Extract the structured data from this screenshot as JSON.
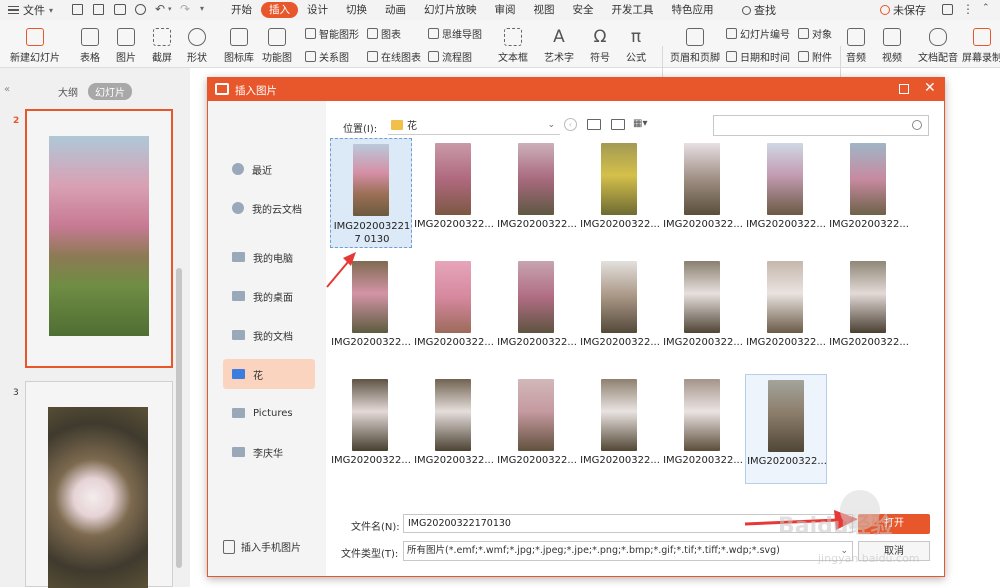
{
  "app": {
    "menu_label": "文件",
    "tabs": [
      "开始",
      "插入",
      "设计",
      "切换",
      "动画",
      "幻灯片放映",
      "审阅",
      "视图",
      "安全",
      "开发工具",
      "特色应用"
    ],
    "active_tab": "插入",
    "search_label": "查找",
    "save_status": "未保存"
  },
  "ribbon": {
    "new_slide": "新建幻灯片",
    "table": "表格",
    "picture": "图片",
    "screenshot": "截屏",
    "shape": "形状",
    "icon_lib": "图标库",
    "func_chart": "功能图",
    "smart_art": "智能图形",
    "chart": "图表",
    "mindmap": "思维导图",
    "relation": "关系图",
    "online_chart": "在线图表",
    "flowchart": "流程图",
    "textbox": "文本框",
    "art_text": "艺术字",
    "symbol": "符号",
    "formula": "公式",
    "header_footer": "页眉和页脚",
    "slide_number": "幻灯片编号",
    "object": "对象",
    "date_time": "日期和时间",
    "attachment": "附件",
    "audio": "音频",
    "video": "视频",
    "narration": "文档配音",
    "screen_record": "屏幕录制"
  },
  "left_panel": {
    "tab_outline": "大纲",
    "tab_slides": "幻灯片",
    "slide_numbers": [
      "2",
      "3"
    ]
  },
  "dialog": {
    "title": "插入图片",
    "location_label": "位置(I):",
    "location_value": "花",
    "search_placeholder": "",
    "sidebar": [
      {
        "label": "最近",
        "icon": "clock-icon"
      },
      {
        "label": "我的云文档",
        "icon": "cloud-doc-icon"
      },
      {
        "label": "我的电脑",
        "icon": "computer-icon"
      },
      {
        "label": "我的桌面",
        "icon": "desktop-icon"
      },
      {
        "label": "我的文档",
        "icon": "folder-icon"
      },
      {
        "label": "花",
        "icon": "folder-icon"
      },
      {
        "label": "Pictures",
        "icon": "folder-icon"
      },
      {
        "label": "李庆华",
        "icon": "folder-icon"
      }
    ],
    "active_sidebar_index": 5,
    "phone_picture": "插入手机图片",
    "files": [
      {
        "name": "IMG20200322170130",
        "caption": "IMG2020032217 0130"
      },
      {
        "name": "IMG20200322...",
        "caption": "IMG20200322..."
      },
      {
        "name": "IMG20200322...",
        "caption": "IMG20200322..."
      },
      {
        "name": "IMG20200322...",
        "caption": "IMG20200322..."
      },
      {
        "name": "IMG20200322...",
        "caption": "IMG20200322..."
      },
      {
        "name": "IMG20200322...",
        "caption": "IMG20200322..."
      },
      {
        "name": "IMG20200322...",
        "caption": "IMG20200322..."
      },
      {
        "name": "IMG20200322...",
        "caption": "IMG20200322..."
      },
      {
        "name": "IMG20200322...",
        "caption": "IMG20200322..."
      },
      {
        "name": "IMG20200322...",
        "caption": "IMG20200322..."
      },
      {
        "name": "IMG20200322...",
        "caption": "IMG20200322..."
      },
      {
        "name": "IMG20200322...",
        "caption": "IMG20200322..."
      },
      {
        "name": "IMG20200322...",
        "caption": "IMG20200322..."
      },
      {
        "name": "IMG20200322...",
        "caption": "IMG20200322..."
      },
      {
        "name": "IMG20200322...",
        "caption": "IMG20200322..."
      },
      {
        "name": "IMG20200322...",
        "caption": "IMG20200322..."
      },
      {
        "name": "IMG20200322...",
        "caption": "IMG20200322..."
      },
      {
        "name": "IMG20200322...",
        "caption": "IMG20200322..."
      },
      {
        "name": "IMG20200322...",
        "caption": "IMG20200322..."
      },
      {
        "name": "IMG20200322...",
        "caption": "IMG20200322..."
      }
    ],
    "selected_index": 0,
    "hover_index": 19,
    "filename_label": "文件名(N):",
    "filename_value": "IMG20200322170130",
    "filetype_label": "文件类型(T):",
    "filetype_value": "所有图片(*.emf;*.wmf;*.jpg;*.jpeg;*.jpe;*.png;*.bmp;*.gif;*.tif;*.tiff;*.wdp;*.svg)",
    "open_button": "打开",
    "cancel_button": "取消"
  },
  "watermark": {
    "text": "Baidu经验",
    "url": "jingyan.baidu.com"
  },
  "colors": {
    "accent": "#e8562b",
    "selected_sidebar": "#fbd4bf",
    "selected_file": "#dce9f7"
  }
}
